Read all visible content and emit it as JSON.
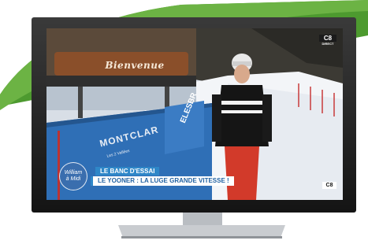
{
  "banner": {
    "title": "LE BANC D'ESSAI",
    "subtitle": "LE YOONER : LA LUGE GRANDE VITESSE !"
  },
  "show_logo": {
    "line1": "William",
    "line2": "à Midi"
  },
  "channel": {
    "name": "C8",
    "badge": "DIRECT"
  },
  "scene_text": {
    "sign": "Bienvenue",
    "fence_brand": "MONTCLAR",
    "fence_sub": "Les 2 Vallées",
    "fence_side": "ELESBR"
  },
  "colors": {
    "accent_green": "#4d9a2f",
    "banner_blue": "#2f87c8",
    "tv_frame": "#1e1e1e"
  },
  "icons": [
    "tv-stand-icon",
    "channel-logo-icon",
    "show-logo-icon"
  ]
}
